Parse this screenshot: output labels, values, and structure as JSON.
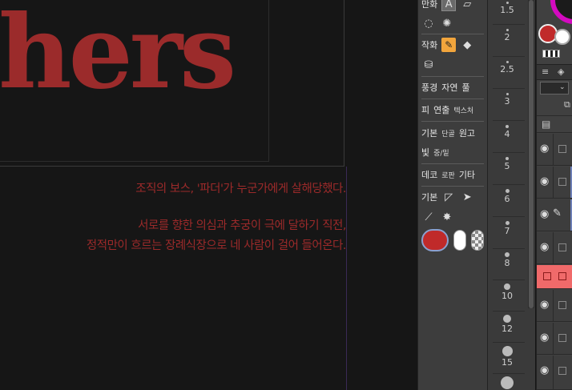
{
  "canvas": {
    "title_text": "hers",
    "subtitle_lines": [
      "조직의 보스, '파더'가 누군가에게 살해당했다.",
      "서로를 향한 의심과 추궁이 극에 달하기 직전,",
      "정적만이 흐르는 장례식장으로 네 사람이 걸어 들어온다."
    ],
    "text_color": "#9b2b2b"
  },
  "subtool_panel": {
    "rows": [
      {
        "label": "만화",
        "icons": [
          "text-icon",
          "frame-icon"
        ]
      },
      {
        "label": "",
        "icons": [
          "balloon-icon",
          "burst-line-icon"
        ]
      },
      {
        "label": "작화",
        "icons": [
          "pen-icon",
          "eraser-icon"
        ]
      },
      {
        "label": "",
        "icons": [
          "fill-bucket-icon"
        ]
      },
      {
        "label": "풍경",
        "items": [
          "자연",
          "풀"
        ]
      },
      {
        "label": "피",
        "items": [
          "연출",
          "텍스처"
        ]
      },
      {
        "label": "기본",
        "items": [
          "단골",
          "원고"
        ]
      },
      {
        "label": "빛",
        "items": [
          "중/밑"
        ]
      },
      {
        "label": "데코",
        "items": [
          "로판",
          "기타"
        ]
      },
      {
        "label": "기본",
        "icons": [
          "ruler-icon",
          "select-arrow-icon"
        ]
      },
      {
        "label": "",
        "icons": [
          "eyedropper-icon",
          "sparkle-icon"
        ]
      }
    ],
    "colors": {
      "main": "#c02a2a",
      "sub": "#ffffff"
    }
  },
  "brush_sizes": {
    "items": [
      "1.5",
      "2",
      "2.5",
      "3",
      "4",
      "5",
      "6",
      "7",
      "8",
      "10",
      "12",
      "15"
    ]
  },
  "right_panel": {
    "color_main": "#c02a2a",
    "color_sub": "#ffffff",
    "wheel_color": "#d40ac0",
    "tab_icons": [
      "menu-icon",
      "layers-icon"
    ],
    "blend_mode": "",
    "selected_layer_color": "#f06a6a"
  }
}
